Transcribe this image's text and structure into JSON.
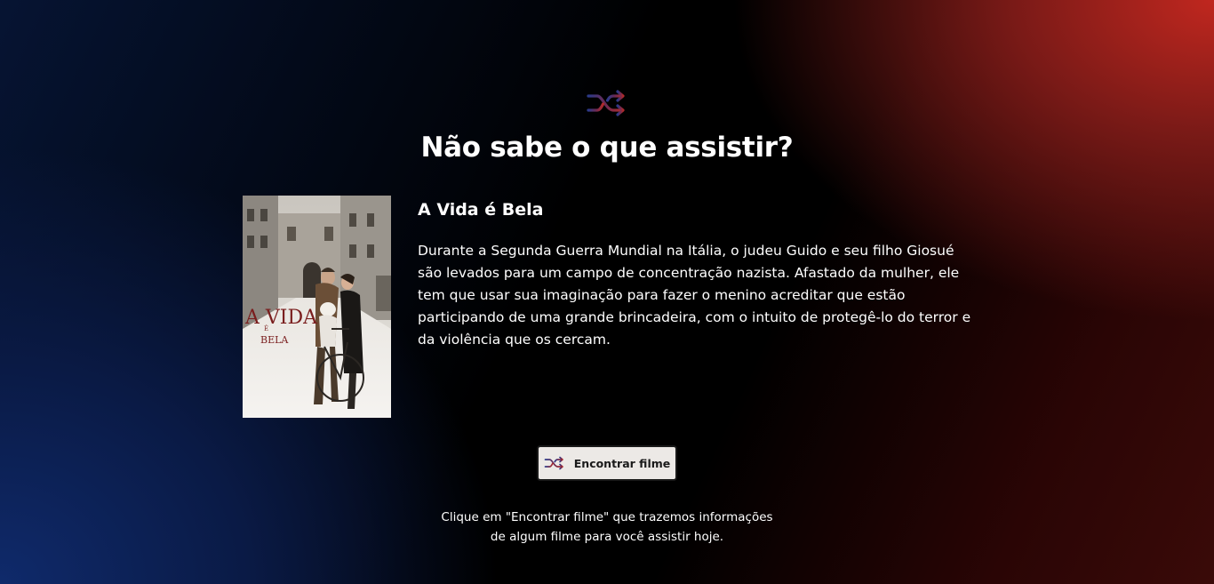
{
  "header": {
    "icon": "shuffle-icon",
    "title": "Não sabe o que assistir?"
  },
  "movie": {
    "title": "A Vida é Bela",
    "description": "Durante a Segunda Guerra Mundial na Itália, o judeu Guido e seu filho Giosué são levados para um campo de concentração nazista. Afastado da mulher, ele tem que usar sua imaginação para fazer o menino acreditar que estão participando de uma grande brincadeira, com o intuito de protegê-lo do terror e da violência que os cercam.",
    "poster": {
      "title_line1": "A VIDA",
      "title_line2": "É",
      "title_line3": "BELA"
    }
  },
  "action": {
    "button_label": "Encontrar filme",
    "button_icon": "shuffle-icon"
  },
  "hint": {
    "line1": "Clique em \"Encontrar filme\" que trazemos informações",
    "line2": "de algum filme para você assistir hoje."
  },
  "colors": {
    "accent_red": "#c0271f",
    "accent_blue": "#0f2a6b",
    "button_bg": "#ece9e6"
  }
}
